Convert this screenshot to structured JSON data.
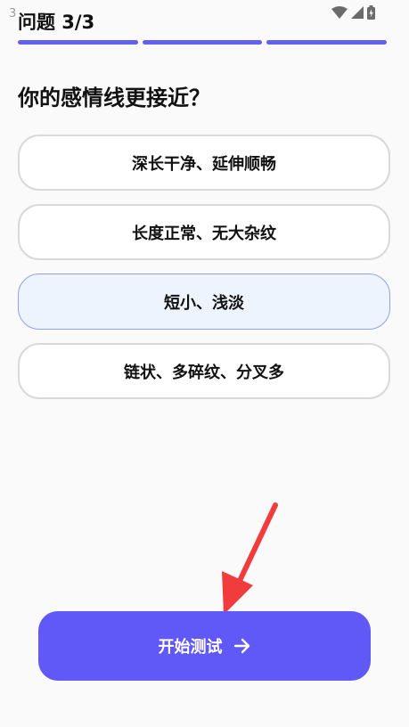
{
  "status_bar": {
    "time": "3",
    "icons": [
      "wifi-icon",
      "cellular-signal-icon",
      "battery-icon"
    ]
  },
  "header": {
    "title": "问题 3/3",
    "progress": {
      "current": 3,
      "total": 3
    }
  },
  "question": {
    "text": "你的感情线更接近？"
  },
  "options": [
    {
      "label": "深长干净、延伸顺畅",
      "selected": false
    },
    {
      "label": "长度正常、无大杂纹",
      "selected": false
    },
    {
      "label": "短小、浅淡",
      "selected": true
    },
    {
      "label": "链状、多碎纹、分叉多",
      "selected": false
    }
  ],
  "start_button": {
    "label": "开始测试",
    "icon": "arrow-right-icon"
  },
  "colors": {
    "accent": "#6058f7",
    "progress": "#6360f0",
    "selected_bg": "#eef4fd",
    "selected_border": "#8fa2e8",
    "annotation_arrow": "#f03c3c"
  }
}
